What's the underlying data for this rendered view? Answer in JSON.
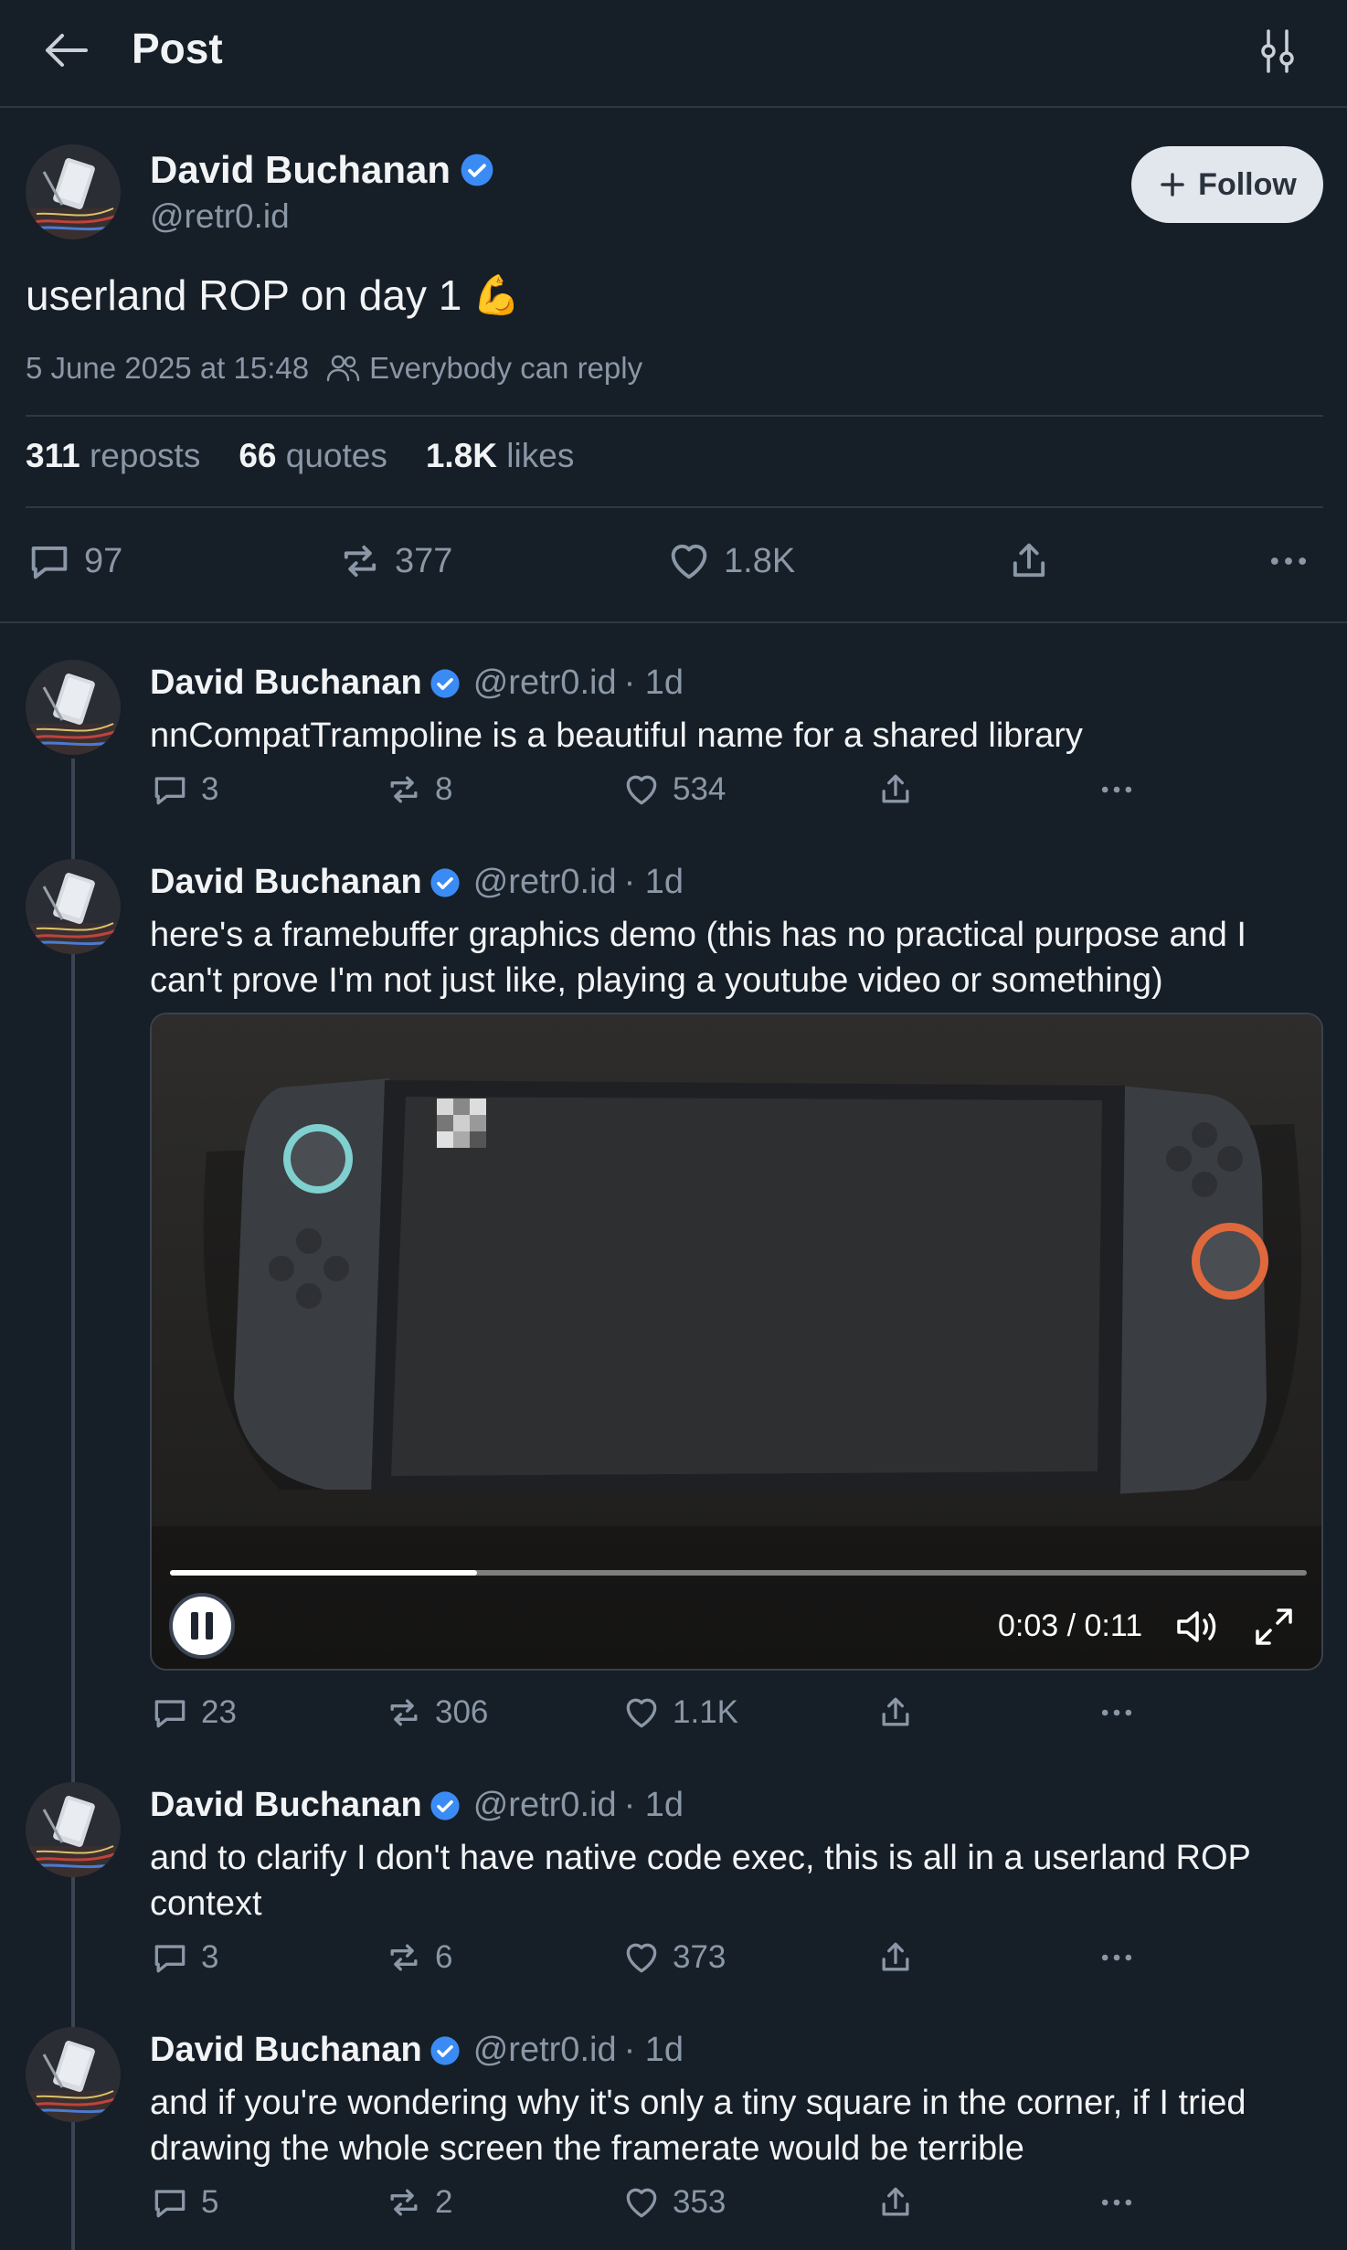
{
  "header": {
    "title": "Post"
  },
  "main_post": {
    "author_name": "David Buchanan",
    "author_handle": "@retr0.id",
    "follow_label": "Follow",
    "text": "userland ROP on day 1",
    "emoji": "💪",
    "timestamp": "5 June 2025 at 15:48",
    "reply_setting": "Everybody can reply",
    "stats": [
      {
        "value": "311",
        "label": "reposts"
      },
      {
        "value": "66",
        "label": "quotes"
      },
      {
        "value": "1.8K",
        "label": "likes"
      }
    ],
    "actions": {
      "replies": "97",
      "reposts": "377",
      "likes": "1.8K"
    }
  },
  "replies": [
    {
      "author_name": "David Buchanan",
      "author_handle": "@retr0.id",
      "age": "· 1d",
      "text": "nnCompatTrampoline is a beautiful name for a shared library",
      "replies": "3",
      "reposts": "8",
      "likes": "534"
    },
    {
      "author_name": "David Buchanan",
      "author_handle": "@retr0.id",
      "age": "· 1d",
      "text": "here's a framebuffer graphics demo (this has no practical purpose and I can't prove I'm not just like, playing a youtube video or something)",
      "video": {
        "time": "0:03 / 0:11",
        "progress": 0.27
      },
      "replies": "23",
      "reposts": "306",
      "likes": "1.1K"
    },
    {
      "author_name": "David Buchanan",
      "author_handle": "@retr0.id",
      "age": "· 1d",
      "text": "and to clarify I don't have native code exec, this is all in a userland ROP context",
      "replies": "3",
      "reposts": "6",
      "likes": "373"
    },
    {
      "author_name": "David Buchanan",
      "author_handle": "@retr0.id",
      "age": "· 1d",
      "text": "and if you're wondering why it's only a tiny square in the corner, if I tried drawing the whole screen the framerate would be terrible",
      "replies": "5",
      "reposts": "2",
      "likes": "353"
    }
  ],
  "colors": {
    "background": "#161e27",
    "muted": "#8a97a6",
    "verified": "#3b8bf5",
    "divider": "#2e3845"
  }
}
